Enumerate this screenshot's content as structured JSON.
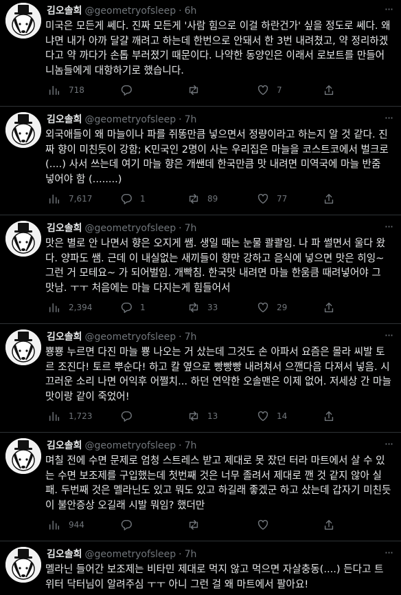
{
  "account": {
    "display_name": "김오솔희",
    "handle": "@geometryofsleep"
  },
  "tweets": [
    {
      "time": "6h",
      "text": "미국은 모든게 쎄다. 진짜 모든게 '사람 힘으로 이걸 하란건가' 싶을 정도로 쎄다. 왜냐면 내가 아까 달걀 깨려고 하는데 한번으로 안돼서 한 3번 내려쳤고, 약 정리하겠다고 약 까다가 손톱 부러졌기 때문이다. 나약한 동양인은 이래서 로보트를 만들어 니놈들에게 대항하기로 했습니다.",
      "views": "718",
      "replies": "",
      "retweets": "",
      "likes": "7"
    },
    {
      "time": "7h",
      "text": "외국애들이 왜 마늘이나 파를 쥐똥만큼 넣으면서 정량이라고 하는지 알 것 같다. 진짜 향이 미친듯이 강함; K민국인 2명이 사는 우리집은 마늘을 코스트코에서 벌크로 (....) 사서 쓰는데 여기 마늘 향은 개쌘데 한국만큼 맛 내려면 미역국에 마늘 반줌 넣어야 함 (........)",
      "views": "7,617",
      "replies": "1",
      "retweets": "89",
      "likes": "77"
    },
    {
      "time": "7h",
      "text": "맛은 별로 안 나면서 향은 오지게 쌤. 생일 때는 눈물 콸콸임. 나 파 썰면서 울다 왔다. 양파도 쌤. 근데 이 내실없는 새끼들이 향만 강하고 음식에 넣으면 맛은 히잉~ 그런 거 모테요~ 가 되어벌임. 개빡침. 한국맛 내려면 마늘 한움큼 때려넣어야 그 맛남. ㅜㅜ 처음에는 마늘 다지는게 힘들어서",
      "views": "2,394",
      "replies": "1",
      "retweets": "33",
      "likes": "29"
    },
    {
      "time": "7h",
      "text": "뿅뿅 누르면 다진 마늘 뿅 나오는 거 샀는데 그것도 손 아파서 요즘은 몰라 씨발 토르 조진다! 토르 뿌순다! 하고 칼 옆으로 빵빵빵 내려쳐서 으깬다음 다져서 넣음. 시끄러운 소리 나면 어익후 어쩔치... 하던 연약한 오솔맨은 이제 없어. 저세상 간 마늘 맛이랑 같이 죽었어!",
      "views": "1,723",
      "replies": "",
      "retweets": "13",
      "likes": "14"
    },
    {
      "time": "7h",
      "text": "며칠 전에 수면 문제로 엄청 스트레스 받고 제대로 못 잤던 터라 마트에서 살 수 있는 수면 보조제를 구입했는데 첫번째 것은 너무 졸려서 제대로 깬 것 같지 않아 실패. 두번째 것은 멜라닌도 있고 뭐도 있고 하길래 좋겠군 하고 샀는데 갑자기 미친듯이 불안증상 오길래 시발 뭐임? 했더만",
      "views": "944",
      "replies": "",
      "retweets": "",
      "likes": ""
    },
    {
      "time": "7h",
      "text": "멜라닌 들어간 보조제는 비타민 제대로 먹지 않고 먹으면 자살충동(....) 든다고 트위터 닥터님이 알려주심 ㅜㅜ 아니 그런 걸 왜 마트에서 팔아요!",
      "views": "",
      "replies": "",
      "retweets": "",
      "likes": ""
    }
  ],
  "icons": {
    "views": "bar-chart-icon",
    "reply": "speech-bubble-icon",
    "retweet": "retweet-arrows-icon",
    "like": "heart-icon",
    "share": "share-upload-icon",
    "more": "ellipsis-icon"
  },
  "colors": {
    "background": "#000000",
    "text": "#e7e9ea",
    "muted": "#71767b",
    "divider": "#2f3336"
  }
}
